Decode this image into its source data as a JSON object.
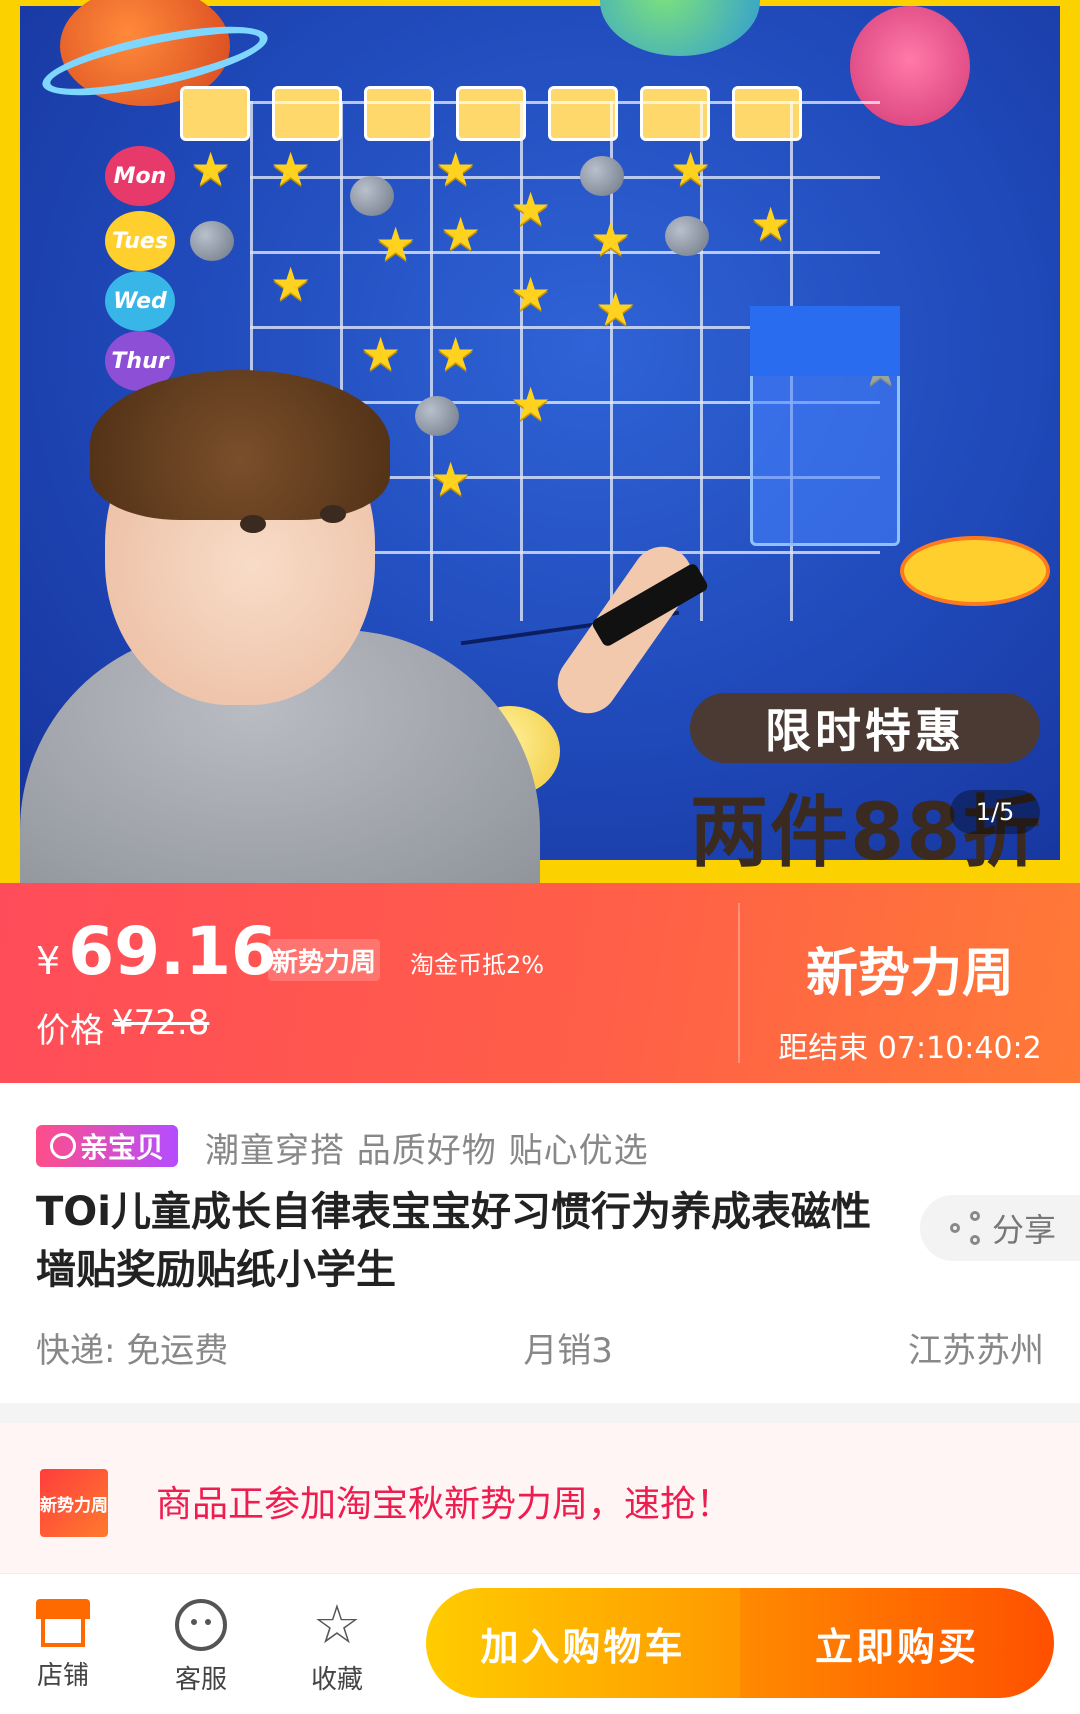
{
  "hero": {
    "days": [
      "Mon",
      "Tues",
      "Wed",
      "Thur"
    ],
    "promo_line1": "限时特惠",
    "promo_line2": "两件88折",
    "page_indicator": "1/5"
  },
  "price": {
    "currency": "¥",
    "current": "69.16",
    "event_tag": "新势力周",
    "coin_note": "淘金币抵2%",
    "orig_label": "价格",
    "orig_value": "¥72.8",
    "event_title": "新势力周",
    "countdown": "距结束 07:10:40:2"
  },
  "product": {
    "badge": "亲宝贝",
    "tagline": "潮童穿搭 品质好物 贴心优选",
    "title": "TOi儿童成长自律表宝宝好习惯行为养成表磁性墙贴奖励贴纸小学生",
    "share_label": "分享",
    "shipping": "快递: 免运费",
    "monthly_sales": "月销3",
    "location": "江苏苏州"
  },
  "notice": {
    "logo_text": "新势力周",
    "text": "商品正参加淘宝秋新势力周，速抢！"
  },
  "bottom_bar": {
    "shop_label": "店铺",
    "service_label": "客服",
    "favorite_label": "收藏",
    "add_cart_label": "加入购物车",
    "buy_now_label": "立即购买"
  },
  "colors": {
    "price_banner": "#ff5048",
    "cart_button": "#ffaa00",
    "buy_button": "#ff6a00",
    "notice_text": "#ee1d4f"
  },
  "icons": [
    "share-icon",
    "shop-icon",
    "customer-service-icon",
    "star-icon"
  ]
}
